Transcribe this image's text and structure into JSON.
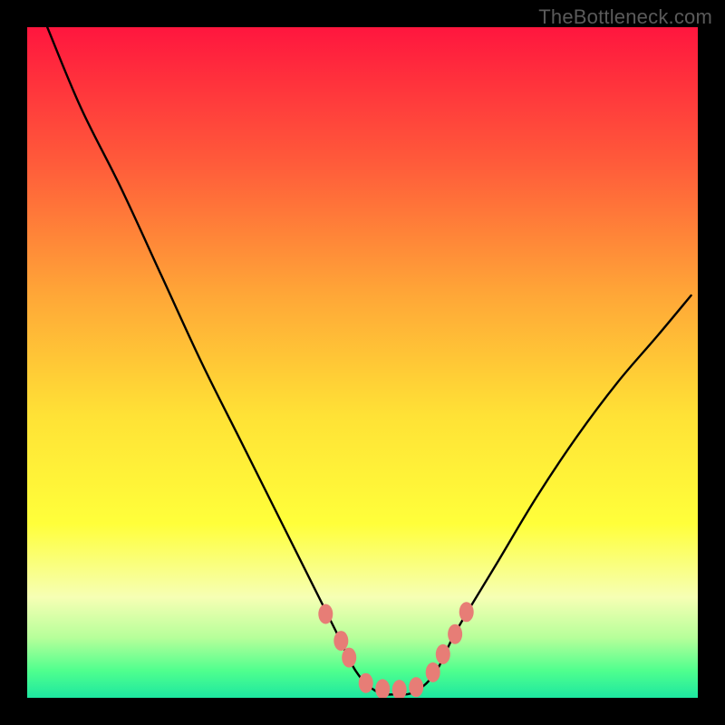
{
  "watermark": "TheBottleneck.com",
  "colors": {
    "frame": "#000000",
    "gradient_top": "#ff163e",
    "gradient_mid1": "#ff5a3a",
    "gradient_mid2": "#ffa737",
    "gradient_mid3": "#ffe236",
    "gradient_yellow": "#ffff3a",
    "gradient_pale": "#f6ffb4",
    "gradient_green1": "#b7ff9a",
    "gradient_green2": "#4fff8e",
    "gradient_teal": "#1de7a0",
    "curve": "#000000",
    "markers": "#e77d76"
  },
  "chart_data": {
    "type": "line",
    "title": "",
    "xlabel": "",
    "ylabel": "",
    "xlim": [
      0,
      100
    ],
    "ylim": [
      0,
      100
    ],
    "series": [
      {
        "name": "bottleneck-curve",
        "x": [
          3,
          8,
          14,
          20,
          26,
          32,
          38,
          42,
          46,
          49,
          52,
          55,
          58,
          61,
          64,
          70,
          76,
          82,
          88,
          94,
          99
        ],
        "y": [
          100,
          88,
          76,
          63,
          50,
          38,
          26,
          18,
          10,
          4,
          1,
          0.5,
          1,
          4,
          10,
          20,
          30,
          39,
          47,
          54,
          60
        ]
      }
    ],
    "markers": {
      "name": "highlight-points",
      "x": [
        44.5,
        46.8,
        48.0,
        50.5,
        53.0,
        55.5,
        58.0,
        60.5,
        62.0,
        63.8,
        65.5
      ],
      "y": [
        12.5,
        8.5,
        6.0,
        2.2,
        1.3,
        1.2,
        1.6,
        3.8,
        6.5,
        9.5,
        12.8
      ]
    }
  }
}
